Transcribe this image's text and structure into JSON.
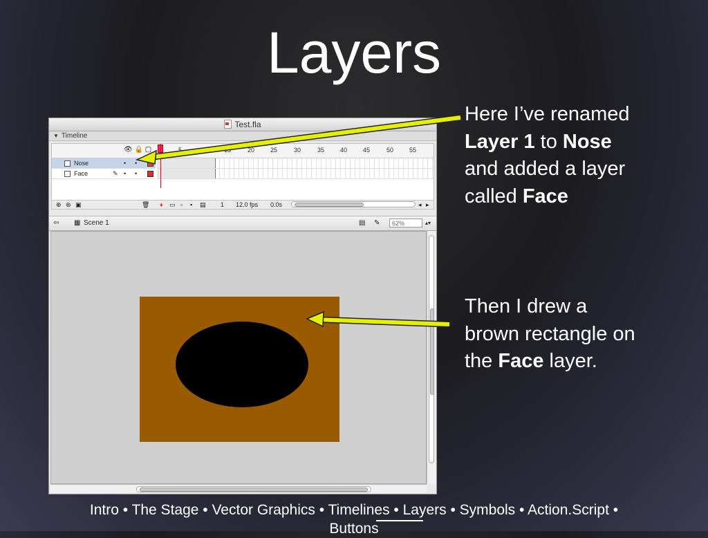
{
  "slide": {
    "title": "Layers",
    "callout1": {
      "line1": "Here I’ve renamed",
      "line2_bold_a": "Layer 1",
      "line2_mid": " to ",
      "line2_bold_b": "Nose",
      "line3": "and added a layer",
      "line4_pre": "called ",
      "line4_bold": "Face"
    },
    "callout2": {
      "line1": "Then I drew a",
      "line2": "brown rectangle on",
      "line3_pre": "the ",
      "line3_bold": "Face",
      "line3_post": " layer."
    },
    "footer": {
      "text_before": "Intro • The Stage • Vector Graphics • Timelines • Layers • Symbols • Action.Script •",
      "text_wrap": "Buttons"
    },
    "arrow_color": "#e4f000"
  },
  "window": {
    "title": "Test.fla",
    "timeline_label": "Timeline",
    "ruler": [
      "5",
      "10",
      "15",
      "20",
      "25",
      "30",
      "35",
      "40",
      "45",
      "50",
      "55"
    ],
    "layers": [
      {
        "name": "Nose",
        "selected": true,
        "color": "#d94a2b"
      },
      {
        "name": "Face",
        "selected": false,
        "color": "#e22d2d"
      }
    ],
    "footer": {
      "frame": "1",
      "fps": "12.0 fps",
      "time": "0.0s"
    },
    "scene": "Scene 1",
    "zoom": "62%",
    "stage": {
      "rect_color": "#995a00",
      "ellipse_color": "#000000"
    }
  }
}
